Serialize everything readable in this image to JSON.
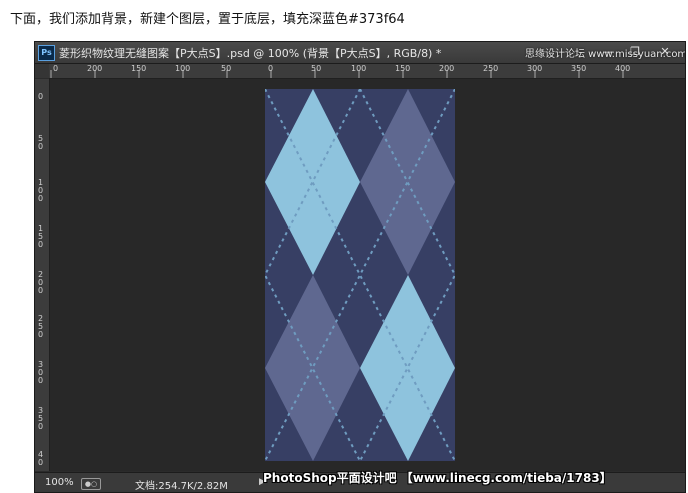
{
  "caption": "下面，我们添加背景，新建个图层，置于底层，填充深蓝色#373f64",
  "window": {
    "app_icon": "Ps",
    "title": "菱形织物纹理无缝图案【P大点S】.psd @ 100% (背景【P大点S】, RGB/8) *",
    "watermark_top": "思缘设计论坛 www.missyuan.com",
    "min_label": "—",
    "restore_label": "❐",
    "close_label": "✕"
  },
  "ruler_top": [
    "0",
    "200",
    "150",
    "100",
    "50",
    "0",
    "50",
    "100",
    "150",
    "200",
    "250",
    "300",
    "350",
    "400"
  ],
  "ruler_left": [
    "0",
    "50",
    "100",
    "150",
    "200",
    "250",
    "300",
    "350",
    "40"
  ],
  "status": {
    "zoom": "100%",
    "doc_info": "文档:254.7K/2.82M",
    "arrow": "▶"
  },
  "watermark_bottom": "PhotoShop平面设计吧 【www.linecg.com/tieba/1783】",
  "colors": {
    "fill_dark_blue": "#373f64",
    "diamond_light": "#8ec3dd",
    "diamond_muted": "#5f6890",
    "stitch": "#6f9cc0"
  },
  "icons": [
    "photoshop-logo-icon",
    "minimize-icon",
    "restore-icon",
    "close-icon",
    "status-icon",
    "arrow-right-icon"
  ]
}
